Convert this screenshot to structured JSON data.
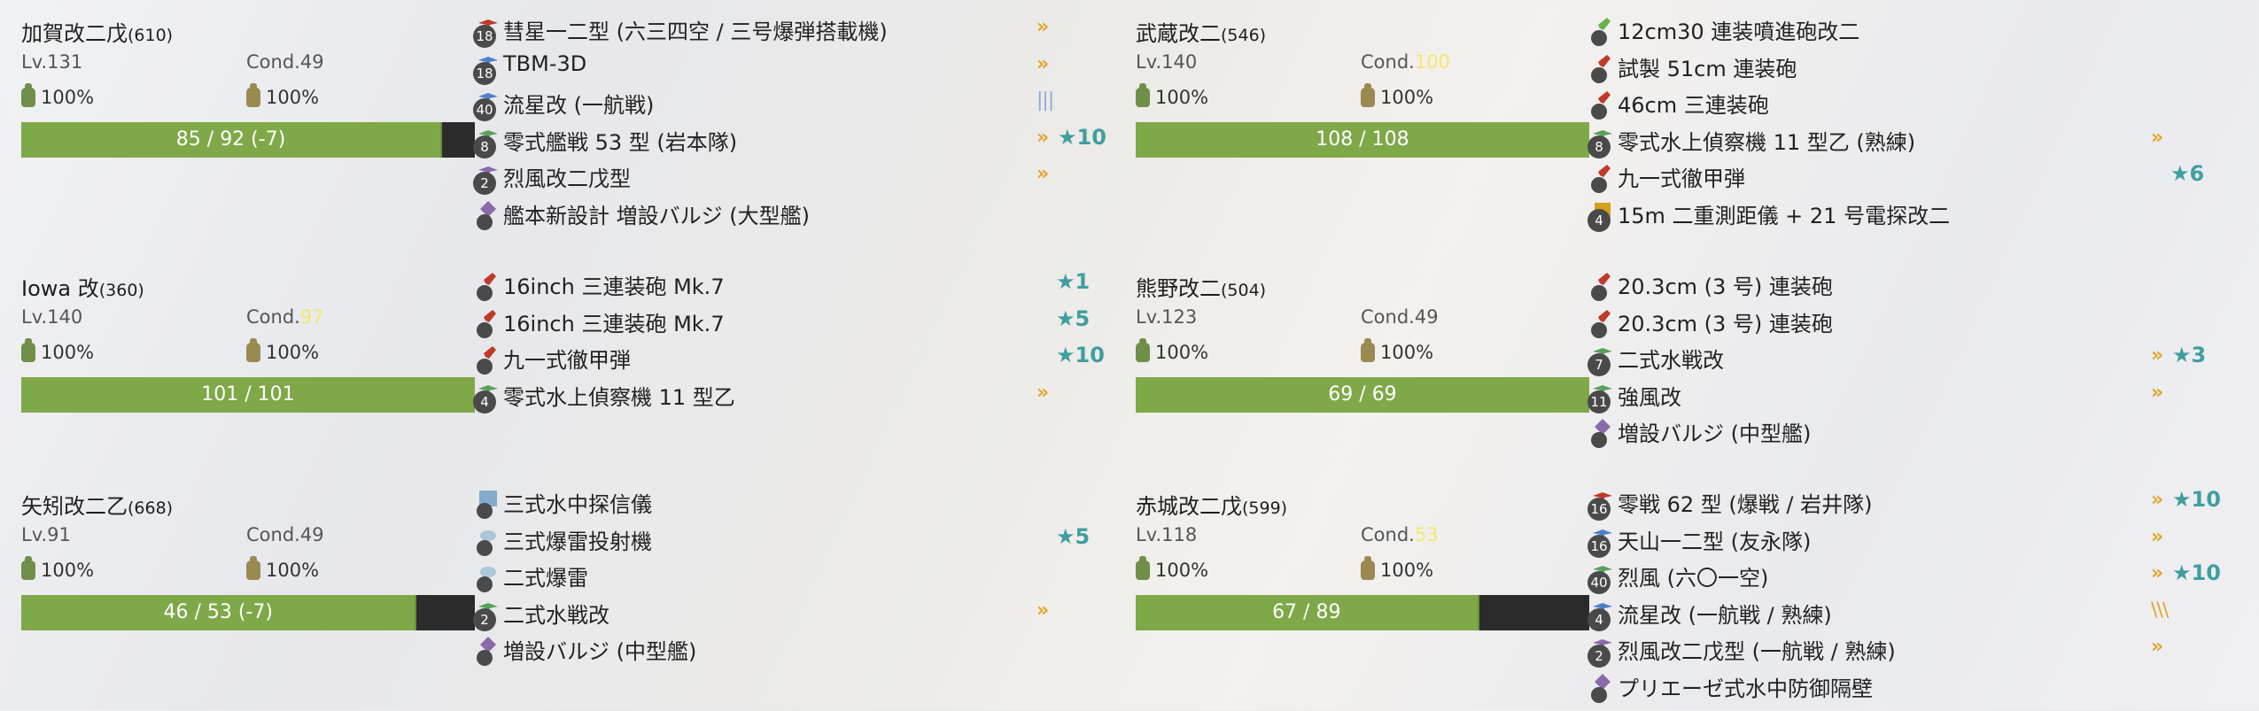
{
  "ships": [
    {
      "name": "加賀改二戊",
      "id": "(610)",
      "level": "Lv.131",
      "cond_label": "Cond.",
      "cond": "49",
      "cond_sparkle": false,
      "fuel": "100%",
      "ammo": "100%",
      "hp_text": "85 / 92 (-7)",
      "hp_fraction": 0.924,
      "equipment": [
        {
          "icon": "dive-bomber-icon",
          "icon_color": "#c0392b",
          "slot": "18",
          "name": "彗星一二型 (六三四空 / 三号爆弾搭載機)",
          "prof": "»",
          "star": ""
        },
        {
          "icon": "torpedo-bomber-icon",
          "icon_color": "#4f7fc9",
          "slot": "18",
          "name": "TBM-3D",
          "prof": "»",
          "star": ""
        },
        {
          "icon": "torpedo-bomber-icon",
          "icon_color": "#4f7fc9",
          "slot": "40",
          "name": "流星改 (一航戦)",
          "prof": "|||",
          "star": ""
        },
        {
          "icon": "fighter-icon",
          "icon_color": "#5aa05a",
          "slot": "8",
          "name": "零式艦戦 53 型 (岩本隊)",
          "prof": "»",
          "star": "★10"
        },
        {
          "icon": "jet-bomber-icon",
          "icon_color": "#8a6aa8",
          "slot": "2",
          "name": "烈風改二戊型",
          "prof": "»",
          "star": ""
        },
        {
          "icon": "bulge-icon",
          "icon_color": "#8a6aa8",
          "slot": "",
          "name": "艦本新設計 増設バルジ (大型艦)",
          "prof": "",
          "star": ""
        }
      ]
    },
    {
      "name": "武蔵改二",
      "id": "(546)",
      "level": "Lv.140",
      "cond_label": "Cond.",
      "cond": "100",
      "cond_sparkle": true,
      "fuel": "100%",
      "ammo": "100%",
      "hp_text": "108 / 108",
      "hp_fraction": 1.0,
      "equipment": [
        {
          "icon": "secondary-gun-icon",
          "icon_color": "#6ab04c",
          "slot": "",
          "name": "12cm30 連装噴進砲改二",
          "prof": "",
          "star": ""
        },
        {
          "icon": "main-gun-icon",
          "icon_color": "#c0392b",
          "slot": "",
          "name": "試製 51cm 連装砲",
          "prof": "",
          "star": ""
        },
        {
          "icon": "main-gun-icon",
          "icon_color": "#c0392b",
          "slot": "",
          "name": "46cm 三連装砲",
          "prof": "",
          "star": ""
        },
        {
          "icon": "seaplane-icon",
          "icon_color": "#5aa05a",
          "slot": "8",
          "name": "零式水上偵察機 11 型乙 (熟練)",
          "prof": "»",
          "star": ""
        },
        {
          "icon": "ap-shell-icon",
          "icon_color": "#c0392b",
          "slot": "",
          "name": "九一式徹甲弾",
          "prof": "",
          "star": "★6"
        },
        {
          "icon": "radar-icon",
          "icon_color": "#d4a017",
          "slot": "4",
          "name": "15m 二重測距儀 + 21 号電探改二",
          "prof": "",
          "star": ""
        }
      ]
    },
    {
      "name": "Iowa 改",
      "id": "(360)",
      "level": "Lv.140",
      "cond_label": "Cond.",
      "cond": "97",
      "cond_sparkle": true,
      "fuel": "100%",
      "ammo": "100%",
      "hp_text": "101 / 101",
      "hp_fraction": 1.0,
      "equipment": [
        {
          "icon": "main-gun-icon",
          "icon_color": "#c0392b",
          "slot": "",
          "name": "16inch 三連装砲 Mk.7",
          "prof": "",
          "star": "★1"
        },
        {
          "icon": "main-gun-icon",
          "icon_color": "#c0392b",
          "slot": "",
          "name": "16inch 三連装砲 Mk.7",
          "prof": "",
          "star": "★5"
        },
        {
          "icon": "ap-shell-icon",
          "icon_color": "#c0392b",
          "slot": "",
          "name": "九一式徹甲弾",
          "prof": "",
          "star": "★10"
        },
        {
          "icon": "seaplane-icon",
          "icon_color": "#5aa05a",
          "slot": "4",
          "name": "零式水上偵察機 11 型乙",
          "prof": "»",
          "star": ""
        }
      ]
    },
    {
      "name": "熊野改二",
      "id": "(504)",
      "level": "Lv.123",
      "cond_label": "Cond.",
      "cond": "49",
      "cond_sparkle": false,
      "fuel": "100%",
      "ammo": "100%",
      "hp_text": "69 / 69",
      "hp_fraction": 1.0,
      "equipment": [
        {
          "icon": "main-gun-icon",
          "icon_color": "#c0392b",
          "slot": "",
          "name": "20.3cm (3 号) 連装砲",
          "prof": "",
          "star": ""
        },
        {
          "icon": "main-gun-icon",
          "icon_color": "#c0392b",
          "slot": "",
          "name": "20.3cm (3 号) 連装砲",
          "prof": "",
          "star": ""
        },
        {
          "icon": "seaplane-fighter-icon",
          "icon_color": "#5aa05a",
          "slot": "7",
          "name": "二式水戦改",
          "prof": "»",
          "star": "★3"
        },
        {
          "icon": "seaplane-fighter-icon",
          "icon_color": "#5aa05a",
          "slot": "11",
          "name": "強風改",
          "prof": "»",
          "star": ""
        },
        {
          "icon": "bulge-icon",
          "icon_color": "#8a6aa8",
          "slot": "",
          "name": "増設バルジ (中型艦)",
          "prof": "",
          "star": ""
        }
      ]
    },
    {
      "name": "矢矧改二乙",
      "id": "(668)",
      "level": "Lv.91",
      "cond_label": "Cond.",
      "cond": "49",
      "cond_sparkle": false,
      "fuel": "100%",
      "ammo": "100%",
      "hp_text": "46 / 53 (-7)",
      "hp_fraction": 0.868,
      "equipment": [
        {
          "icon": "sonar-icon",
          "icon_color": "#5a8fbf",
          "slot": "",
          "name": "三式水中探信儀",
          "prof": "",
          "star": ""
        },
        {
          "icon": "depth-charge-icon",
          "icon_color": "#7fb0c8",
          "slot": "",
          "name": "三式爆雷投射機",
          "prof": "",
          "star": "★5"
        },
        {
          "icon": "depth-charge-icon",
          "icon_color": "#7fb0c8",
          "slot": "",
          "name": "二式爆雷",
          "prof": "",
          "star": ""
        },
        {
          "icon": "seaplane-fighter-icon",
          "icon_color": "#5aa05a",
          "slot": "2",
          "name": "二式水戦改",
          "prof": "»",
          "star": ""
        },
        {
          "icon": "bulge-icon",
          "icon_color": "#8a6aa8",
          "slot": "",
          "name": "増設バルジ (中型艦)",
          "prof": "",
          "star": ""
        }
      ]
    },
    {
      "name": "赤城改二戊",
      "id": "(599)",
      "level": "Lv.118",
      "cond_label": "Cond.",
      "cond": "53",
      "cond_sparkle": true,
      "fuel": "100%",
      "ammo": "100%",
      "hp_text": "67 / 89",
      "hp_fraction": 0.753,
      "equipment": [
        {
          "icon": "fighter-bomber-icon",
          "icon_color": "#c0392b",
          "slot": "16",
          "name": "零戦 62 型 (爆戦 / 岩井隊)",
          "prof": "»",
          "star": "★10"
        },
        {
          "icon": "torpedo-bomber-icon",
          "icon_color": "#4f7fc9",
          "slot": "16",
          "name": "天山一二型 (友永隊)",
          "prof": "»",
          "star": ""
        },
        {
          "icon": "fighter-icon",
          "icon_color": "#5aa05a",
          "slot": "40",
          "name": "烈風 (六〇一空)",
          "prof": "»",
          "star": "★10"
        },
        {
          "icon": "torpedo-bomber-icon",
          "icon_color": "#4f7fc9",
          "slot": "4",
          "name": "流星改 (一航戦 / 熟練)",
          "prof": "\\\\\\",
          "star": ""
        },
        {
          "icon": "jet-bomber-icon",
          "icon_color": "#8a6aa8",
          "slot": "2",
          "name": "烈風改二戊型 (一航戦 / 熟練)",
          "prof": "»",
          "star": ""
        },
        {
          "icon": "bulge-icon",
          "icon_color": "#8a6aa8",
          "slot": "",
          "name": "プリエーゼ式水中防御隔壁",
          "prof": "",
          "star": ""
        }
      ]
    }
  ]
}
